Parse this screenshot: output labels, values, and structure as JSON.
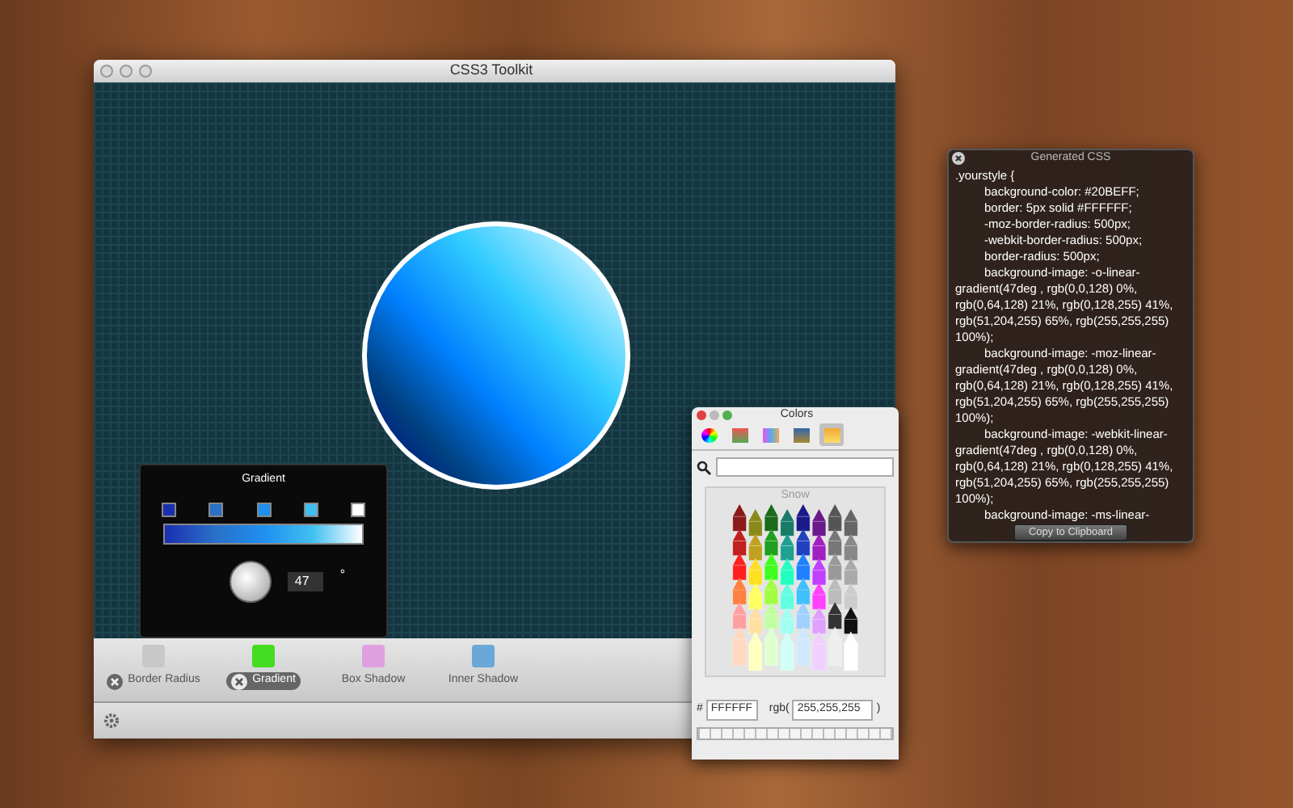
{
  "main_window": {
    "title": "CSS3 Toolkit"
  },
  "gradient_popover": {
    "title": "Gradient",
    "stops": [
      {
        "color": "#1a2fb0"
      },
      {
        "color": "#2a6fc8"
      },
      {
        "color": "#1f8ff0"
      },
      {
        "color": "#40c0f0"
      },
      {
        "color": "#ffffff"
      }
    ],
    "angle": "47",
    "degree_sign": "°"
  },
  "toolbar": {
    "items": [
      {
        "label": "Border Radius",
        "active": true,
        "selected": false,
        "color": "#c8c8c8"
      },
      {
        "label": "Gradient",
        "active": true,
        "selected": true,
        "color": "#44dd22"
      },
      {
        "label": "Box Shadow",
        "active": false,
        "selected": false,
        "color": "#e0a0e0"
      },
      {
        "label": "Inner Shadow",
        "active": false,
        "selected": false,
        "color": "#6aa8d8"
      }
    ]
  },
  "colors_panel": {
    "title": "Colors",
    "modes": [
      {
        "selected": false
      },
      {
        "selected": false
      },
      {
        "selected": false
      },
      {
        "selected": false
      },
      {
        "selected": true
      }
    ],
    "crayon_label": "Snow",
    "hex_label": "#",
    "hex_value": "FFFFFF",
    "rgb_label": "rgb(",
    "rgb_value": "255,255,255",
    "rgb_close": ")"
  },
  "css_panel": {
    "title": "Generated CSS",
    "lines": [
      {
        "text": ".yourstyle {",
        "indented": false
      },
      {
        "text": "background-color: #20BEFF;",
        "indented": true
      },
      {
        "text": "border: 5px solid #FFFFFF;",
        "indented": true
      },
      {
        "text": "-moz-border-radius: 500px;",
        "indented": true
      },
      {
        "text": "-webkit-border-radius: 500px;",
        "indented": true
      },
      {
        "text": "border-radius: 500px;",
        "indented": true
      },
      {
        "text": "background-image: -o-linear-gradient(47deg , rgb(0,0,128) 0%, rgb(0,64,128) 21%, rgb(0,128,255) 41%, rgb(51,204,255) 65%, rgb(255,255,255) 100%);",
        "indented": true
      },
      {
        "text": "background-image: -moz-linear-gradient(47deg , rgb(0,0,128) 0%, rgb(0,64,128) 21%, rgb(0,128,255) 41%, rgb(51,204,255) 65%, rgb(255,255,255) 100%);",
        "indented": true
      },
      {
        "text": "background-image: -webkit-linear-gradient(47deg , rgb(0,0,128) 0%, rgb(0,64,128) 21%, rgb(0,128,255) 41%, rgb(51,204,255) 65%, rgb(255,255,255) 100%);",
        "indented": true
      },
      {
        "text": "background-image: -ms-linear-",
        "indented": true
      }
    ],
    "button": "Copy to Clipboard"
  }
}
